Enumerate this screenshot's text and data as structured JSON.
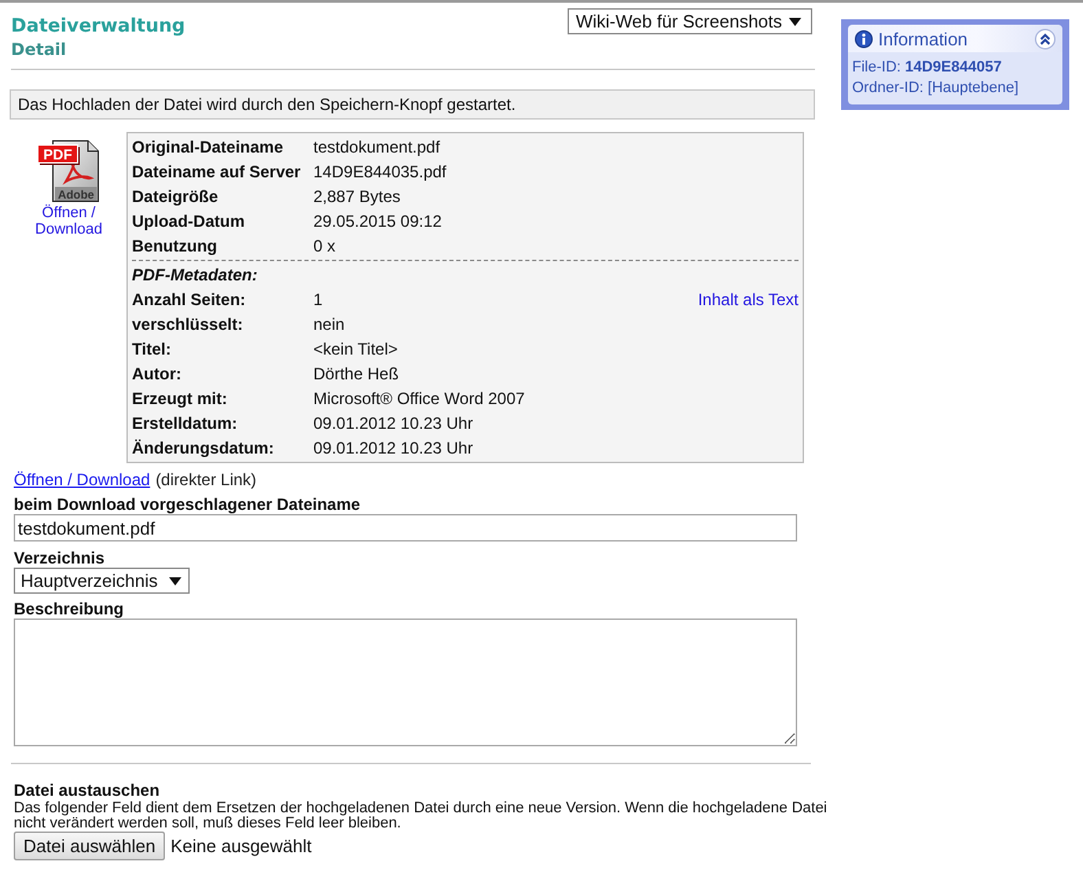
{
  "header": {
    "title": "Dateiverwaltung",
    "subtitle": "Detail"
  },
  "wiki_select": {
    "value": "Wiki-Web für Screenshots"
  },
  "notice": "Das Hochladen der Datei wird durch den Speichern-Knopf gestartet.",
  "file": {
    "icon_badge": "PDF",
    "icon_brand": "Adobe",
    "icon_link": "Öffnen / Download",
    "details": [
      {
        "label": "Original-Dateiname",
        "value": "testdokument.pdf"
      },
      {
        "label": "Dateiname auf Server",
        "value": "14D9E844035.pdf"
      },
      {
        "label": "Dateigröße",
        "value": "2,887 Bytes"
      },
      {
        "label": "Upload-Datum",
        "value": "29.05.2015 09:12"
      },
      {
        "label": "Benutzung",
        "value": "0 x"
      }
    ],
    "metadata_heading": "PDF-Metadaten:",
    "metadata": [
      {
        "label": "Anzahl Seiten:",
        "value": "1",
        "link": "Inhalt als Text"
      },
      {
        "label": "verschlüsselt:",
        "value": "nein"
      },
      {
        "label": "Titel:",
        "value": "<kein Titel>"
      },
      {
        "label": "Autor:",
        "value": "Dörthe Heß"
      },
      {
        "label": "Erzeugt mit:",
        "value": "Microsoft® Office Word 2007"
      },
      {
        "label": "Erstelldatum:",
        "value": "09.01.2012 10.23 Uhr"
      },
      {
        "label": "Änderungsdatum:",
        "value": "09.01.2012 10.23 Uhr"
      }
    ]
  },
  "direct_link": {
    "link": "Öffnen / Download",
    "note": "(direkter Link)"
  },
  "form": {
    "fields": [
      {
        "kind": "text",
        "label": "beim Download vorgeschlagener Dateiname",
        "value": "testdokument.pdf"
      },
      {
        "kind": "select",
        "label": "Verzeichnis",
        "value": "Hauptverzeichnis"
      },
      {
        "kind": "textarea",
        "label": "Beschreibung"
      }
    ]
  },
  "replace": {
    "heading": "Datei austauschen",
    "description": "Das folgender Feld dient dem Ersetzen der hochgeladenen Datei durch eine neue Version. Wenn die hochgeladene Datei nicht verändert werden soll, muß dieses Feld leer bleiben.",
    "button": "Datei auswählen",
    "status": "Keine ausgewählt"
  },
  "info_panel": {
    "title": "Information",
    "expanded": true,
    "lines": [
      "File-ID: **14D9E844057**",
      "Ordner-ID: [Hauptebene]"
    ]
  }
}
